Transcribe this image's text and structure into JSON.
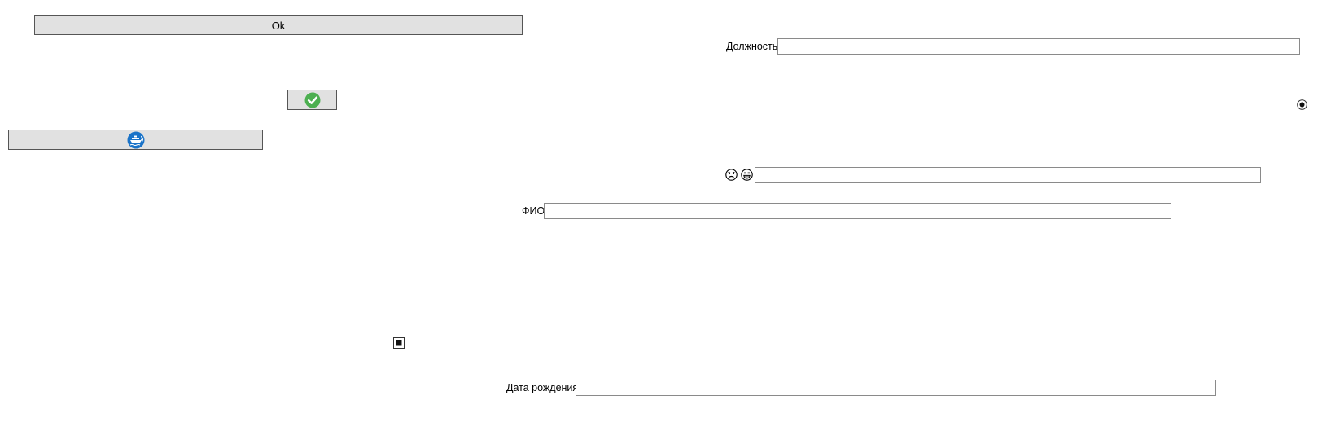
{
  "buttons": {
    "ok_label": "Ok",
    "confirm_icon": "check-circle-icon",
    "ship_icon": "ship-refresh-icon"
  },
  "fields": {
    "position_label": "Должность",
    "position_value": "",
    "fio_label": "ФИО",
    "fio_value": "",
    "birth_label": "Дата рождения",
    "birth_value": "",
    "emoji_value": ""
  },
  "emoji": {
    "first": "sad-face-icon",
    "second": "happy-face-icon"
  },
  "radio": {
    "checked": true
  },
  "checkbox": {
    "checked": true
  },
  "colors": {
    "button_bg": "#e1e1e1",
    "check_green": "#4caf50",
    "ship_blue": "#1a73c8"
  }
}
